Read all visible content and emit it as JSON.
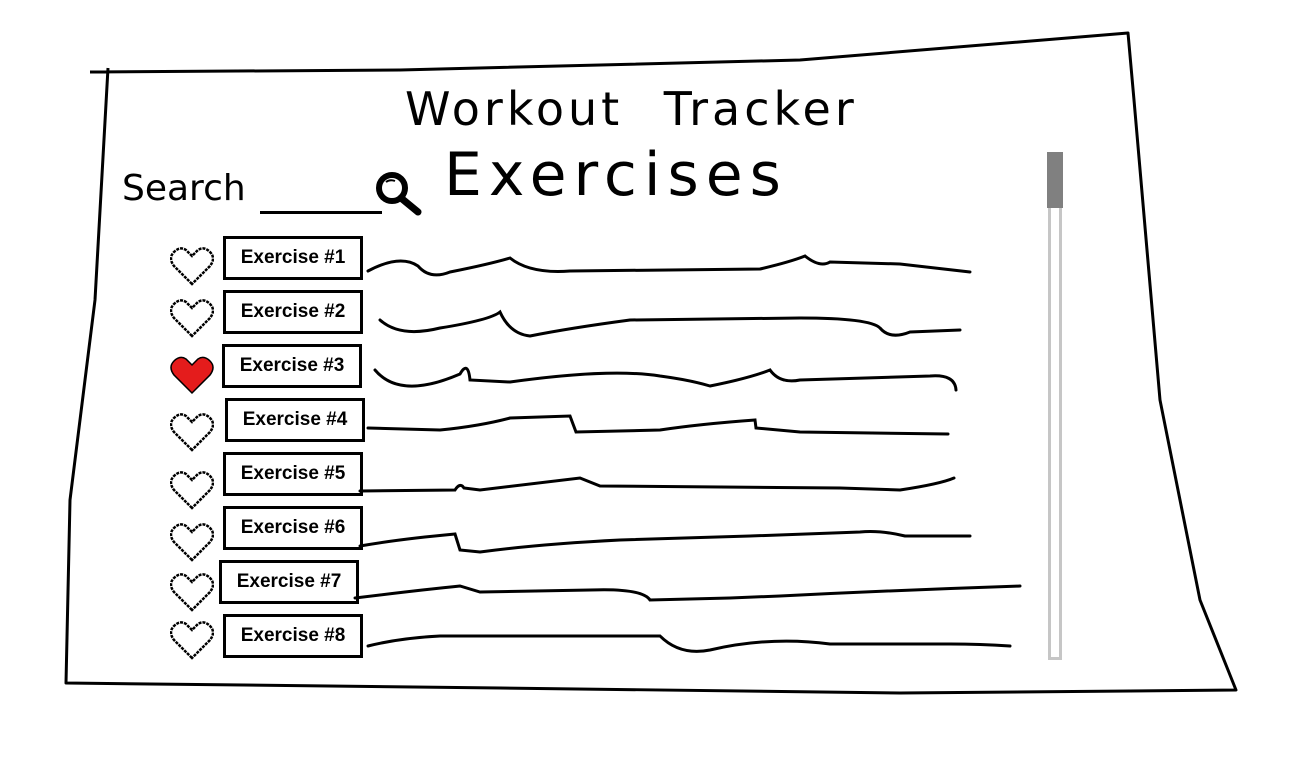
{
  "app": {
    "title": "Workout Tracker"
  },
  "search": {
    "label": "Search",
    "value": "",
    "placeholder": ""
  },
  "exercises": {
    "heading": "Exercises",
    "items": [
      {
        "label": "Exercise #1",
        "favorite": false
      },
      {
        "label": "Exercise #2",
        "favorite": false
      },
      {
        "label": "Exercise #3",
        "favorite": true
      },
      {
        "label": "Exercise #4",
        "favorite": false
      },
      {
        "label": "Exercise #5",
        "favorite": false
      },
      {
        "label": "Exercise #6",
        "favorite": false
      },
      {
        "label": "Exercise #7",
        "favorite": false
      },
      {
        "label": "Exercise #8",
        "favorite": false
      }
    ]
  },
  "icons": {
    "search": "magnifying-glass-icon",
    "favorite": "heart-icon"
  },
  "colors": {
    "ink": "#000000",
    "favorite": "#e41c1c",
    "scroll_thumb": "#808080",
    "scroll_track": "#c6c6c6"
  },
  "scroll": {
    "position": 0
  }
}
